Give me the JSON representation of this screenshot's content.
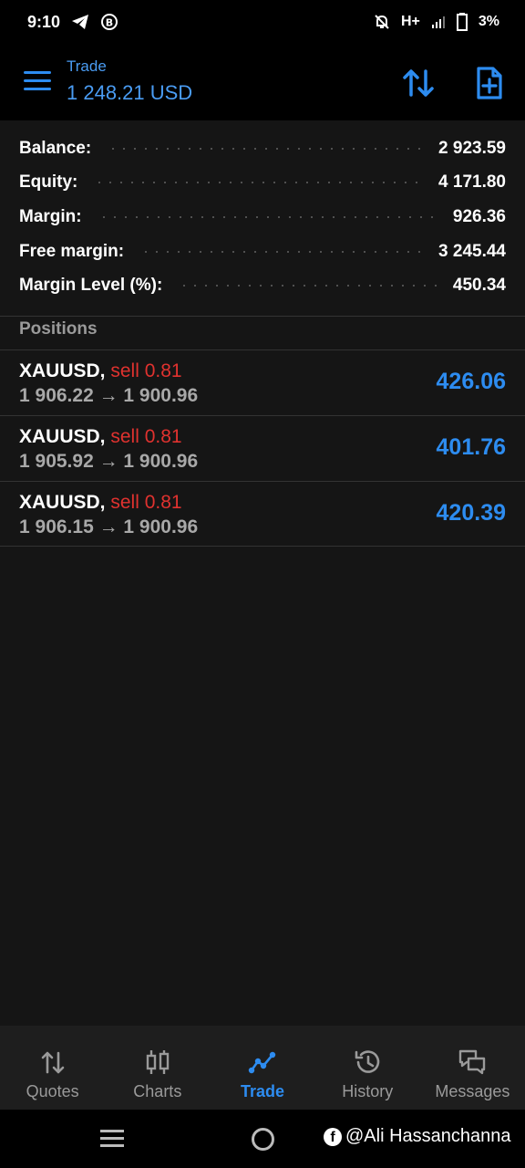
{
  "status_bar": {
    "time": "9:10",
    "network": "H+",
    "battery": "3%",
    "icons": [
      "telegram-icon",
      "b-circle-icon",
      "bell-off-icon",
      "signal-icon",
      "battery-icon"
    ]
  },
  "header": {
    "title": "Trade",
    "subtitle": "1 248.21 USD",
    "icons": [
      "menu-icon",
      "sort-icon",
      "new-order-icon"
    ]
  },
  "summary": [
    {
      "label": "Balance:",
      "value": "2 923.59"
    },
    {
      "label": "Equity:",
      "value": "4 171.80"
    },
    {
      "label": "Margin:",
      "value": "926.36"
    },
    {
      "label": "Free margin:",
      "value": "3 245.44"
    },
    {
      "label": "Margin Level (%):",
      "value": "450.34"
    }
  ],
  "positions_title": "Positions",
  "positions": [
    {
      "symbol": "XAUUSD,",
      "side": "sell 0.81",
      "prices": "1 906.22 → 1 900.96",
      "profit": "426.06"
    },
    {
      "symbol": "XAUUSD,",
      "side": "sell 0.81",
      "prices": "1 905.92 → 1 900.96",
      "profit": "401.76"
    },
    {
      "symbol": "XAUUSD,",
      "side": "sell 0.81",
      "prices": "1 906.15 → 1 900.96",
      "profit": "420.39"
    }
  ],
  "bottom_nav": [
    {
      "label": "Quotes",
      "icon": "quotes-icon",
      "active": false
    },
    {
      "label": "Charts",
      "icon": "charts-icon",
      "active": false
    },
    {
      "label": "Trade",
      "icon": "trade-icon",
      "active": true
    },
    {
      "label": "History",
      "icon": "history-icon",
      "active": false
    },
    {
      "label": "Messages",
      "icon": "messages-icon",
      "active": false
    }
  ],
  "watermark": "@Ali Hassanchanna",
  "colors": {
    "accent": "#2d8cf0",
    "sell": "#e0322f",
    "background": "#151515"
  }
}
